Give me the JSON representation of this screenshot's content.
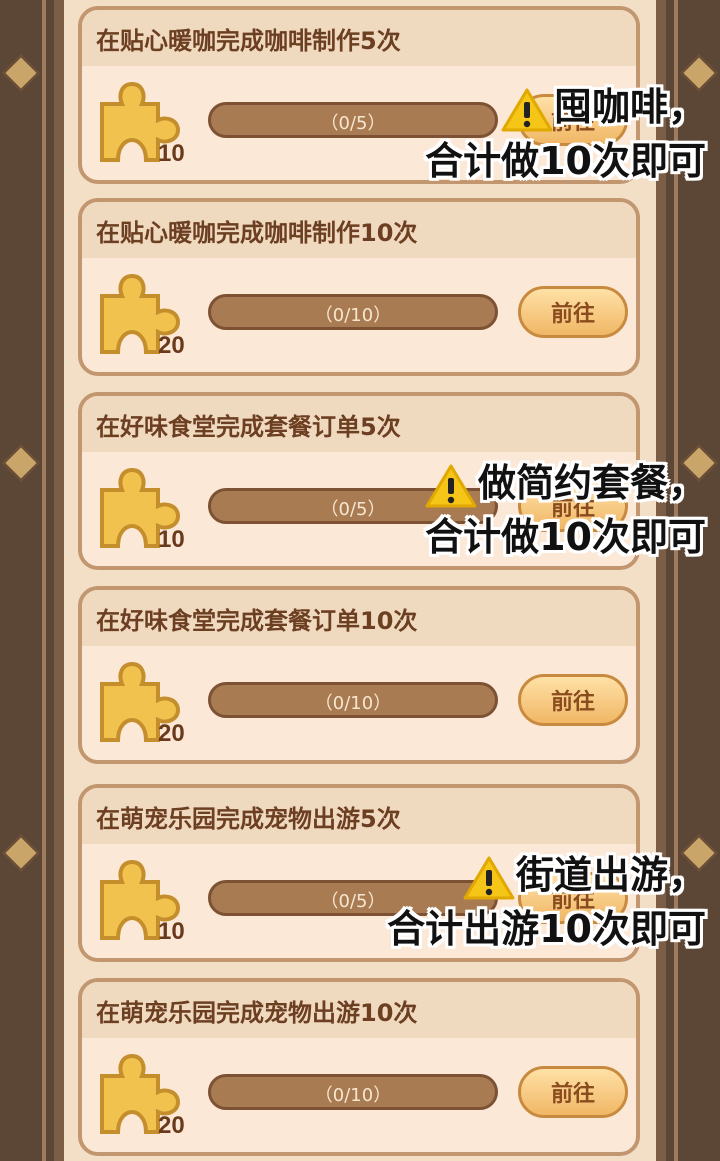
{
  "tasks": [
    {
      "title": "在贴心暖咖完成咖啡制作5次",
      "progress": "（0/5）",
      "reward": "10",
      "button": "前往"
    },
    {
      "title": "在贴心暖咖完成咖啡制作10次",
      "progress": "（0/10）",
      "reward": "20",
      "button": "前往"
    },
    {
      "title": "在好味食堂完成套餐订单5次",
      "progress": "（0/5）",
      "reward": "10",
      "button": "前往"
    },
    {
      "title": "在好味食堂完成套餐订单10次",
      "progress": "（0/10）",
      "reward": "20",
      "button": "前往"
    },
    {
      "title": "在萌宠乐园完成宠物出游5次",
      "progress": "（0/5）",
      "reward": "10",
      "button": "前往"
    },
    {
      "title": "在萌宠乐园完成宠物出游10次",
      "progress": "（0/10）",
      "reward": "20",
      "button": "前往"
    }
  ],
  "notes": [
    {
      "line1": "囤咖啡，",
      "line2": "合计做10次即可"
    },
    {
      "line1": "做简约套餐，",
      "line2": "合计做10次即可"
    },
    {
      "line1": "街道出游，",
      "line2": "合计出游10次即可"
    }
  ],
  "colors": {
    "accent": "#e6b04a",
    "card_border": "#c2966f",
    "title": "#6d3f22"
  }
}
